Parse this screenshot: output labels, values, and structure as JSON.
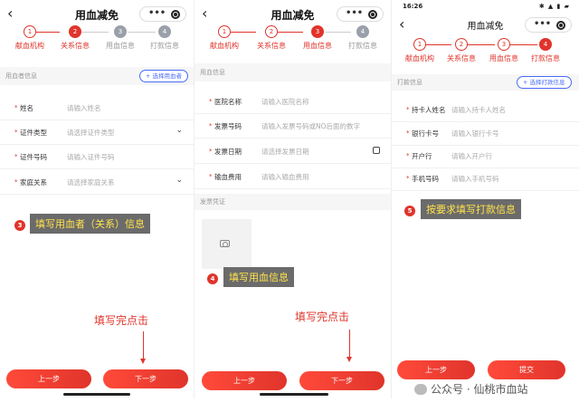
{
  "page_title": "用血减免",
  "status_bar": {
    "time": "16:26",
    "icons": "✱ ▲ ▮ ▰"
  },
  "steps": [
    "献血机构",
    "关系信息",
    "用血信息",
    "打款信息"
  ],
  "panel1": {
    "section_title": "用血者信息",
    "select_button": "+ 选择用血者",
    "fields": [
      {
        "label": "姓名",
        "placeholder": "请输入姓名"
      },
      {
        "label": "证件类型",
        "placeholder": "请选择证件类型"
      },
      {
        "label": "证件号码",
        "placeholder": "请输入证件号码"
      },
      {
        "label": "家庭关系",
        "placeholder": "请选择家庭关系"
      }
    ],
    "badge": "3",
    "callout": "填写用血者（关系）信息",
    "hint": "填写完点击",
    "prev": "上一步",
    "next": "下一步"
  },
  "panel2": {
    "section_title": "用血信息",
    "fields": [
      {
        "label": "医院名称",
        "placeholder": "请输入医院名称"
      },
      {
        "label": "发票号码",
        "placeholder": "请输入发票号码或NO后面的数字"
      },
      {
        "label": "发票日期",
        "placeholder": "请选择发票日期"
      },
      {
        "label": "输血费用",
        "placeholder": "请输入输血费用"
      }
    ],
    "invoice_label": "发票凭证",
    "badge": "4",
    "callout": "填写用血信息",
    "hint": "填写完点击",
    "prev": "上一步",
    "next": "下一步"
  },
  "panel3": {
    "section_title": "打款信息",
    "select_button": "+ 选择打款信息",
    "fields": [
      {
        "label": "持卡人姓名",
        "placeholder": "请输入持卡人姓名"
      },
      {
        "label": "银行卡号",
        "placeholder": "请输入银行卡号"
      },
      {
        "label": "开户行",
        "placeholder": "请输入开户行"
      },
      {
        "label": "手机号码",
        "placeholder": "请输入手机号码"
      }
    ],
    "badge": "5",
    "callout": "按要求填写打款信息",
    "prev": "上一步",
    "submit": "提交"
  },
  "watermark": "公众号 · 仙桃市血站",
  "colors": {
    "accent": "#e0342b",
    "callout_bg": "#6b6b6b",
    "callout_text": "#ffe34a",
    "link": "#4a6cf7"
  }
}
